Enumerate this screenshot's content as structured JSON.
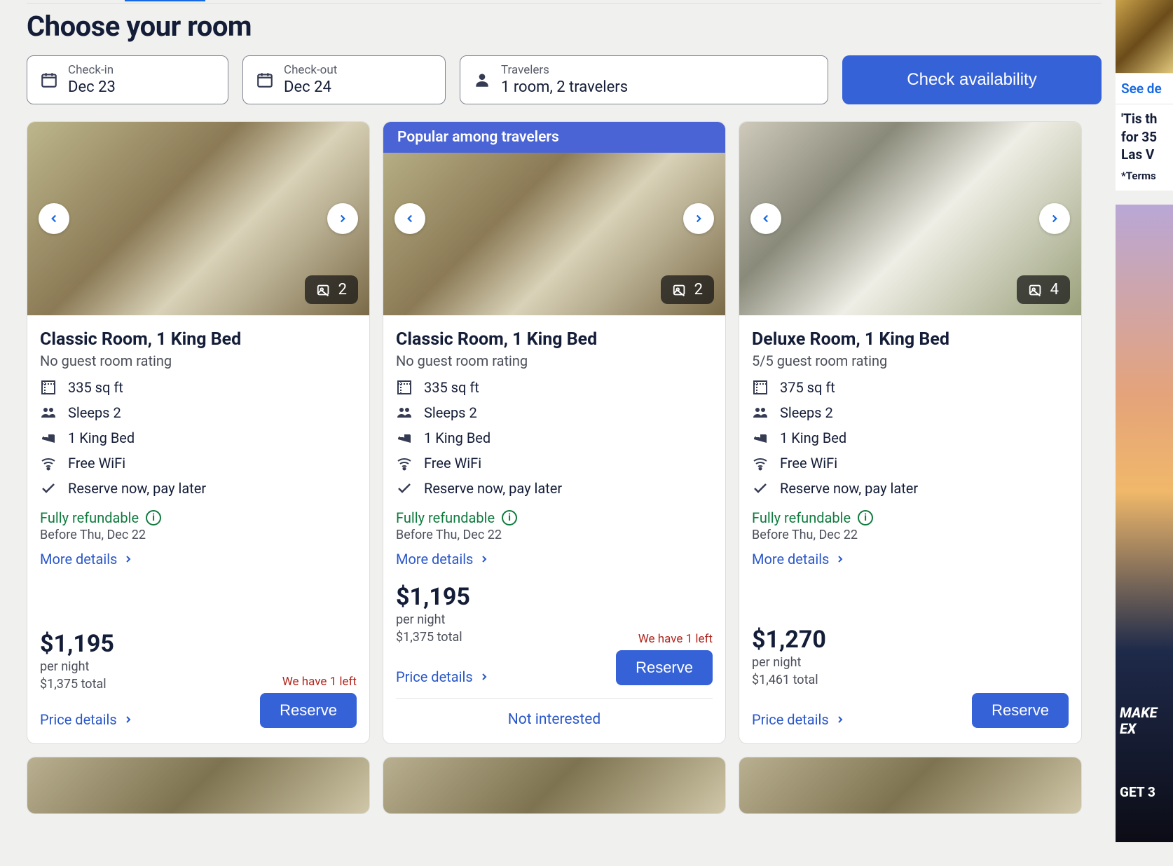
{
  "page": {
    "title": "Choose your room"
  },
  "search": {
    "checkin": {
      "label": "Check-in",
      "value": "Dec 23"
    },
    "checkout": {
      "label": "Check-out",
      "value": "Dec 24"
    },
    "travelers": {
      "label": "Travelers",
      "value": "1 room, 2 travelers"
    },
    "button": "Check availability"
  },
  "common": {
    "more_details": "More details",
    "price_details": "Price details",
    "reserve": "Reserve",
    "per_night": "per night",
    "fully_refundable": "Fully refundable",
    "not_interested": "Not interested"
  },
  "rooms": [
    {
      "banner": "",
      "photo_count": "2",
      "title": "Classic Room, 1 King Bed",
      "rating": "No guest room rating",
      "features": [
        "335 sq ft",
        "Sleeps 2",
        "1 King Bed",
        "Free WiFi",
        "Reserve now, pay later"
      ],
      "refund_before": "Before Thu, Dec 22",
      "price": "$1,195",
      "total": "$1,375 total",
      "scarcity": "We have 1 left"
    },
    {
      "banner": "Popular among travelers",
      "photo_count": "2",
      "title": "Classic Room, 1 King Bed",
      "rating": "No guest room rating",
      "features": [
        "335 sq ft",
        "Sleeps 2",
        "1 King Bed",
        "Free WiFi",
        "Reserve now, pay later"
      ],
      "refund_before": "Before Thu, Dec 22",
      "price": "$1,195",
      "total": "$1,375 total",
      "scarcity": "We have 1 left"
    },
    {
      "banner": "",
      "photo_count": "4",
      "title": "Deluxe Room, 1 King Bed",
      "rating": "5/5 guest room rating",
      "features": [
        "375 sq ft",
        "Sleeps 2",
        "1 King Bed",
        "Free WiFi",
        "Reserve now, pay later"
      ],
      "refund_before": "Before Thu, Dec 22",
      "price": "$1,270",
      "total": "$1,461 total",
      "scarcity": ""
    }
  ],
  "sidebar": {
    "see_deal": "See de",
    "promo_line1": "'Tis th",
    "promo_line2": "for 35",
    "promo_line3": "Las V",
    "terms": "*Terms",
    "ad_make": "MAKE",
    "ad_ext": "EX",
    "ad_get": "GET 3"
  }
}
